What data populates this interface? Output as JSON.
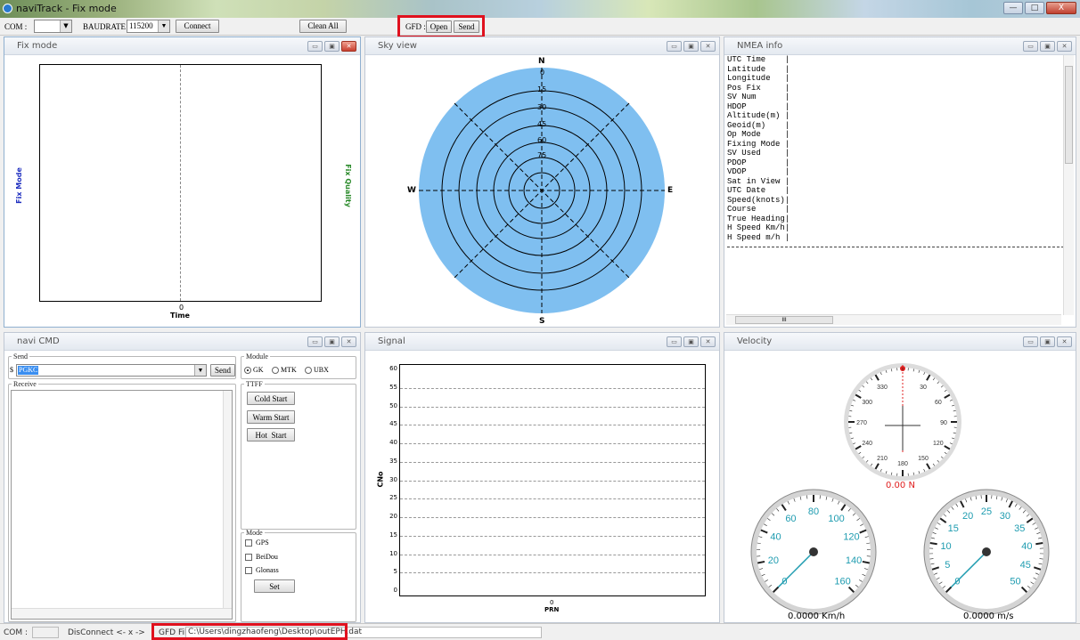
{
  "window": {
    "title": "naviTrack - Fix mode",
    "min_label": "—",
    "max_label": "□",
    "close_label": "X"
  },
  "toolbar": {
    "com_label": "COM :",
    "com_value": "",
    "baud_label": "BAUDRATE :",
    "baud_value": "115200",
    "connect_label": "Connect",
    "clean_label": "Clean All",
    "gfd_label": "GFD :",
    "open_label": "Open",
    "send_label": "Send"
  },
  "panels": {
    "fix_mode": {
      "title": "Fix mode",
      "y_label": "Fix Mode",
      "y2_label": "Fix Quality",
      "x_tick": "0",
      "x_label": "Time"
    },
    "sky_view": {
      "title": "Sky view",
      "north": "N",
      "south": "S",
      "east": "E",
      "west": "W",
      "ring_labels": [
        "0",
        "15",
        "30",
        "45",
        "60",
        "75"
      ]
    },
    "nmea": {
      "title": "NMEA info",
      "rows": [
        "UTC Time",
        "Latitude",
        "Longitude",
        "Pos Fix",
        "SV Num",
        "HDOP",
        "Altitude(m)",
        "Geoid(m)",
        "Op Mode",
        "Fixing Mode",
        "SV Used",
        "PDOP",
        "VDOP",
        "Sat in View",
        "UTC Date",
        "Speed(knots)",
        "Course",
        "True Heading",
        "H Speed Km/h",
        "H Speed m/h"
      ],
      "scroll_center": "III"
    },
    "navi_cmd": {
      "title": "navi CMD",
      "send_group": "Send",
      "dollar": "$",
      "send_value": "PGKC",
      "send_button": "Send",
      "module_group": "Module",
      "module_options": [
        "GK",
        "MTK",
        "UBX"
      ],
      "receive_group": "Receive",
      "ttff_group": "TTFF",
      "cold_start": "Cold Start",
      "warm_start": "Warm Start",
      "hot_start": "Hot  Start",
      "mode_group": "Mode",
      "mode_options": [
        "GPS",
        "BeiDou",
        "Glonass"
      ],
      "set_button": "Set"
    },
    "signal": {
      "title": "Signal",
      "y_label": "CNo",
      "x_label": "PRN",
      "x_tick": "0",
      "y_ticks": [
        "60",
        "55",
        "50",
        "45",
        "40",
        "35",
        "30",
        "25",
        "20",
        "15",
        "10",
        "5",
        "0"
      ]
    },
    "velocity": {
      "title": "Velocity",
      "compass_ticks": [
        "330",
        "30",
        "60",
        "90",
        "120",
        "150",
        "180",
        "210",
        "240",
        "270",
        "300"
      ],
      "heading": "0.00 N",
      "kmh_ticks": [
        "0",
        "20",
        "40",
        "60",
        "80",
        "100",
        "120",
        "140",
        "160"
      ],
      "kmh_readout": "0.0000 Km/h",
      "ms_ticks": [
        "0",
        "5",
        "10",
        "15",
        "20",
        "25",
        "30",
        "35",
        "40",
        "45",
        "50"
      ],
      "ms_readout": "0.0000 m/s"
    }
  },
  "status": {
    "com": "COM :",
    "state": "DisConnect <- x ->",
    "gfd_file_label": "GFD File",
    "gfd_file_path": "C:\\Users\\dingzhaofeng\\Desktop\\outEPH.dat"
  },
  "colors": {
    "sky_fill": "#7fbff0",
    "highlight_red": "#e0111e",
    "heading_red": "#e02020",
    "gauge_teal": "#1f9cb0"
  }
}
